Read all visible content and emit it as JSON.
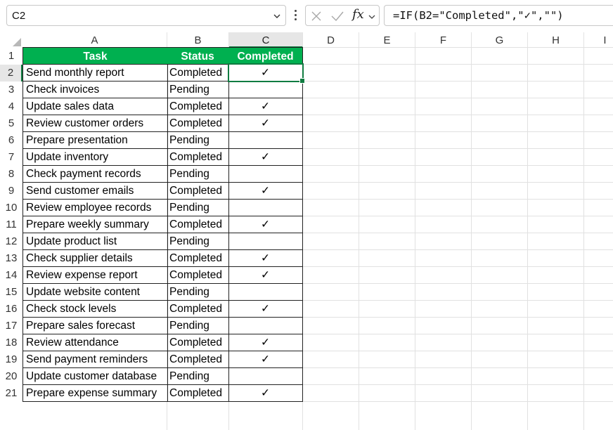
{
  "formula_bar": {
    "name_box": "C2",
    "formula": "=IF(B2=\"Completed\",\"✓\",\"\")",
    "fx_label": "fx"
  },
  "columns": [
    "A",
    "B",
    "C",
    "D",
    "E",
    "F",
    "G",
    "H",
    "I"
  ],
  "selected_column": "C",
  "selected_row": "2",
  "table": {
    "headers": [
      "Task",
      "Status",
      "Completed"
    ],
    "rows": [
      {
        "n": "2",
        "task": "Send monthly report",
        "status": "Completed",
        "check": "✓"
      },
      {
        "n": "3",
        "task": "Check invoices",
        "status": "Pending",
        "check": ""
      },
      {
        "n": "4",
        "task": "Update sales data",
        "status": "Completed",
        "check": "✓"
      },
      {
        "n": "5",
        "task": "Review customer orders",
        "status": "Completed",
        "check": "✓"
      },
      {
        "n": "6",
        "task": "Prepare presentation",
        "status": "Pending",
        "check": ""
      },
      {
        "n": "7",
        "task": "Update inventory",
        "status": "Completed",
        "check": "✓"
      },
      {
        "n": "8",
        "task": "Check payment records",
        "status": "Pending",
        "check": ""
      },
      {
        "n": "9",
        "task": "Send customer emails",
        "status": "Completed",
        "check": "✓"
      },
      {
        "n": "10",
        "task": "Review employee records",
        "status": "Pending",
        "check": ""
      },
      {
        "n": "11",
        "task": "Prepare weekly summary",
        "status": "Completed",
        "check": "✓"
      },
      {
        "n": "12",
        "task": "Update product list",
        "status": "Pending",
        "check": ""
      },
      {
        "n": "13",
        "task": "Check supplier details",
        "status": "Completed",
        "check": "✓"
      },
      {
        "n": "14",
        "task": "Review expense report",
        "status": "Completed",
        "check": "✓"
      },
      {
        "n": "15",
        "task": "Update website content",
        "status": "Pending",
        "check": ""
      },
      {
        "n": "16",
        "task": "Check stock levels",
        "status": "Completed",
        "check": "✓"
      },
      {
        "n": "17",
        "task": "Prepare sales forecast",
        "status": "Pending",
        "check": ""
      },
      {
        "n": "18",
        "task": "Review attendance",
        "status": "Completed",
        "check": "✓"
      },
      {
        "n": "19",
        "task": "Send payment reminders",
        "status": "Completed",
        "check": "✓"
      },
      {
        "n": "20",
        "task": "Update customer database",
        "status": "Pending",
        "check": ""
      },
      {
        "n": "21",
        "task": "Prepare expense summary",
        "status": "Completed",
        "check": "✓"
      }
    ]
  },
  "colors": {
    "header_fill": "#00b050",
    "selection": "#107c41"
  }
}
